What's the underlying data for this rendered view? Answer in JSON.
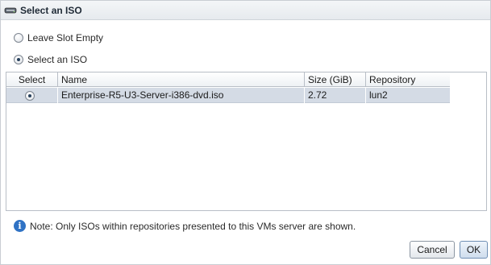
{
  "dialog": {
    "title": "Select an ISO",
    "icon": "disc-drive-icon"
  },
  "options": {
    "leave_empty_label": "Leave Slot Empty",
    "leave_empty_checked": false,
    "select_iso_label": "Select an ISO",
    "select_iso_checked": true
  },
  "table": {
    "columns": [
      "Select",
      "Name",
      "Size (GiB)",
      "Repository"
    ],
    "rows": [
      {
        "selected": true,
        "name": "Enterprise-R5-U3-Server-i386-dvd.iso",
        "size": "2.72",
        "repository": "lun2"
      }
    ]
  },
  "note": {
    "icon": "info-icon",
    "text": "Note: Only ISOs within repositories presented to this VMs server are shown."
  },
  "buttons": {
    "cancel_label": "Cancel",
    "ok_label": "OK"
  },
  "colors": {
    "selected_row": "#d4dbe5",
    "info_icon": "#2f72c4",
    "title_bar": "#e6eaee"
  }
}
